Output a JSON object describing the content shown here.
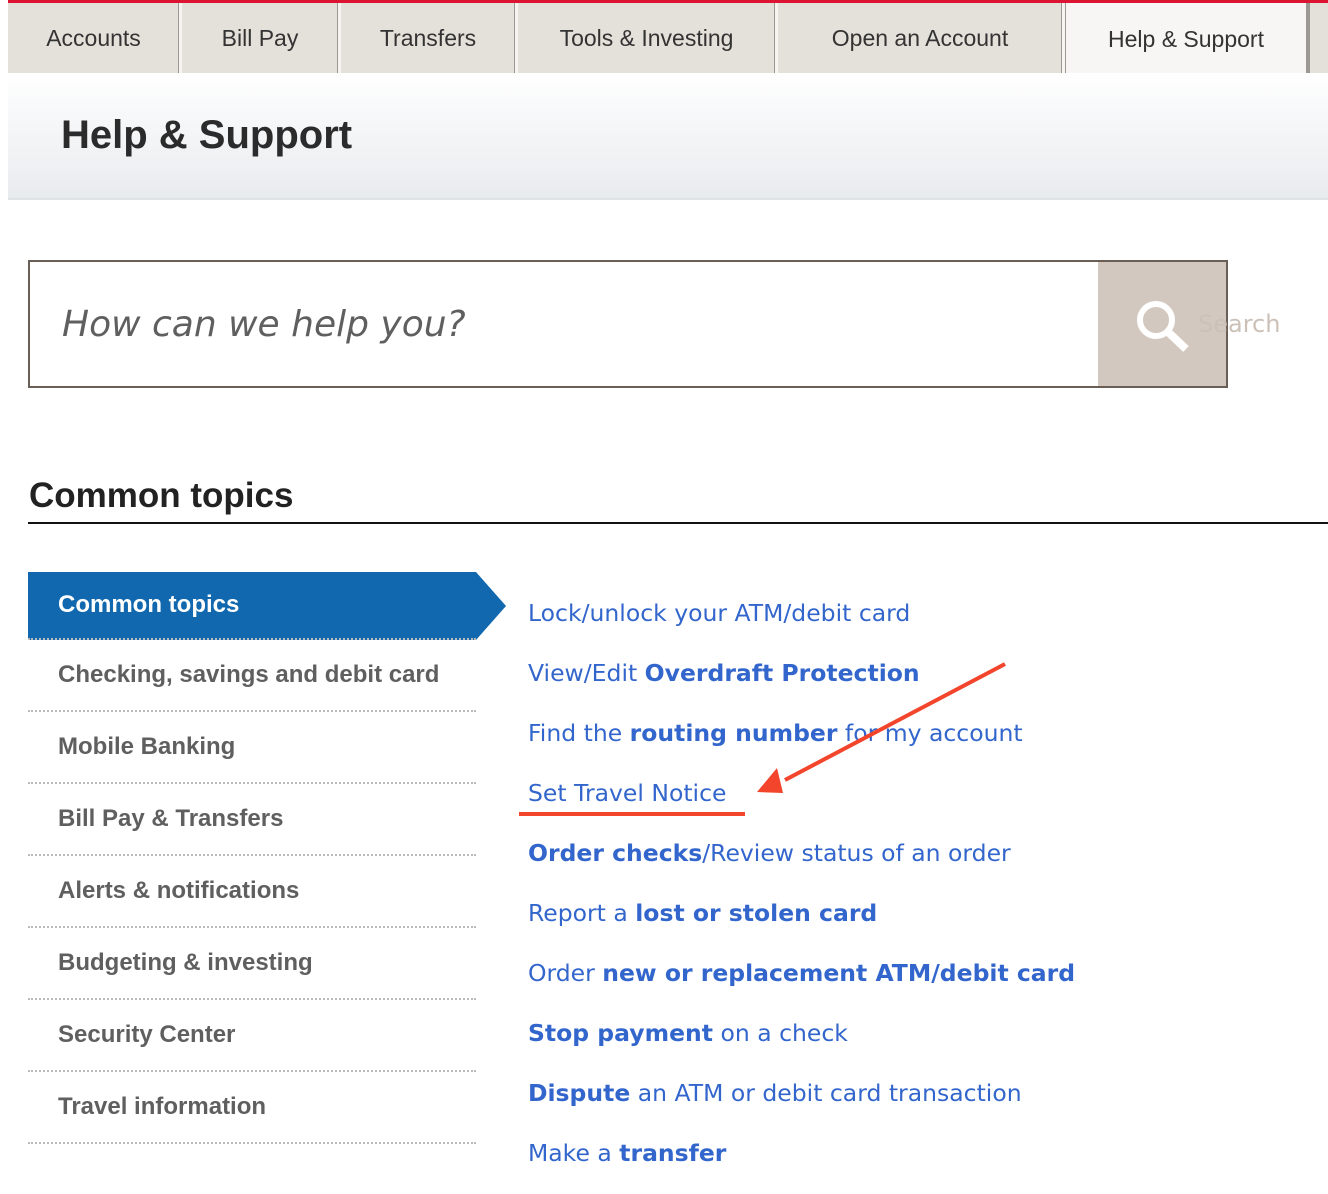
{
  "nav": {
    "tabs": [
      {
        "label": "Accounts",
        "active": false
      },
      {
        "label": "Bill Pay",
        "active": false
      },
      {
        "label": "Transfers",
        "active": false
      },
      {
        "label": "Tools & Investing",
        "active": false
      },
      {
        "label": "Open an Account",
        "active": false
      },
      {
        "label": "Help & Support",
        "active": true
      }
    ]
  },
  "header": {
    "title": "Help & Support"
  },
  "search": {
    "placeholder": "How can we help you?",
    "value": "",
    "button_label": "Search",
    "icon": "search-icon"
  },
  "section": {
    "title": "Common topics"
  },
  "topics": [
    {
      "label": "Common topics",
      "active": true
    },
    {
      "label": "Checking, savings and debit card",
      "active": false
    },
    {
      "label": "Mobile Banking",
      "active": false
    },
    {
      "label": "Bill Pay & Transfers",
      "active": false
    },
    {
      "label": "Alerts & notifications",
      "active": false
    },
    {
      "label": "Budgeting & investing",
      "active": false
    },
    {
      "label": "Security Center",
      "active": false
    },
    {
      "label": "Travel information",
      "active": false
    }
  ],
  "links": [
    {
      "parts": [
        {
          "text": "Lock/unlock your ATM/debit card",
          "bold": false
        }
      ]
    },
    {
      "parts": [
        {
          "text": "View/Edit ",
          "bold": false
        },
        {
          "text": "Overdraft Protection",
          "bold": true
        }
      ]
    },
    {
      "parts": [
        {
          "text": "Find the ",
          "bold": false
        },
        {
          "text": "routing number",
          "bold": true
        },
        {
          "text": " for my account",
          "bold": false
        }
      ]
    },
    {
      "parts": [
        {
          "text": "Set Travel Notice",
          "bold": false
        }
      ],
      "highlighted": true
    },
    {
      "parts": [
        {
          "text": "Order checks",
          "bold": true
        },
        {
          "text": "/Review status of an order",
          "bold": false
        }
      ]
    },
    {
      "parts": [
        {
          "text": "Report a ",
          "bold": false
        },
        {
          "text": "lost or stolen card",
          "bold": true
        }
      ]
    },
    {
      "parts": [
        {
          "text": "Order ",
          "bold": false
        },
        {
          "text": "new or replacement ATM/debit card",
          "bold": true
        }
      ]
    },
    {
      "parts": [
        {
          "text": "Stop payment",
          "bold": true
        },
        {
          "text": " on a check",
          "bold": false
        }
      ]
    },
    {
      "parts": [
        {
          "text": "Dispute",
          "bold": true
        },
        {
          "text": " an ATM or debit card transaction",
          "bold": false
        }
      ]
    },
    {
      "parts": [
        {
          "text": "Make a ",
          "bold": false
        },
        {
          "text": "transfer",
          "bold": true
        }
      ]
    }
  ],
  "annotation": {
    "type": "arrow-and-underline",
    "target": "Set Travel Notice",
    "color": "#f2452c"
  },
  "colors": {
    "accent_red": "#dc1431",
    "link_blue": "#3366cc",
    "active_topic_blue": "#1168ae",
    "nav_bg": "#e4e1da",
    "search_button_bg": "#d2c8bf"
  }
}
